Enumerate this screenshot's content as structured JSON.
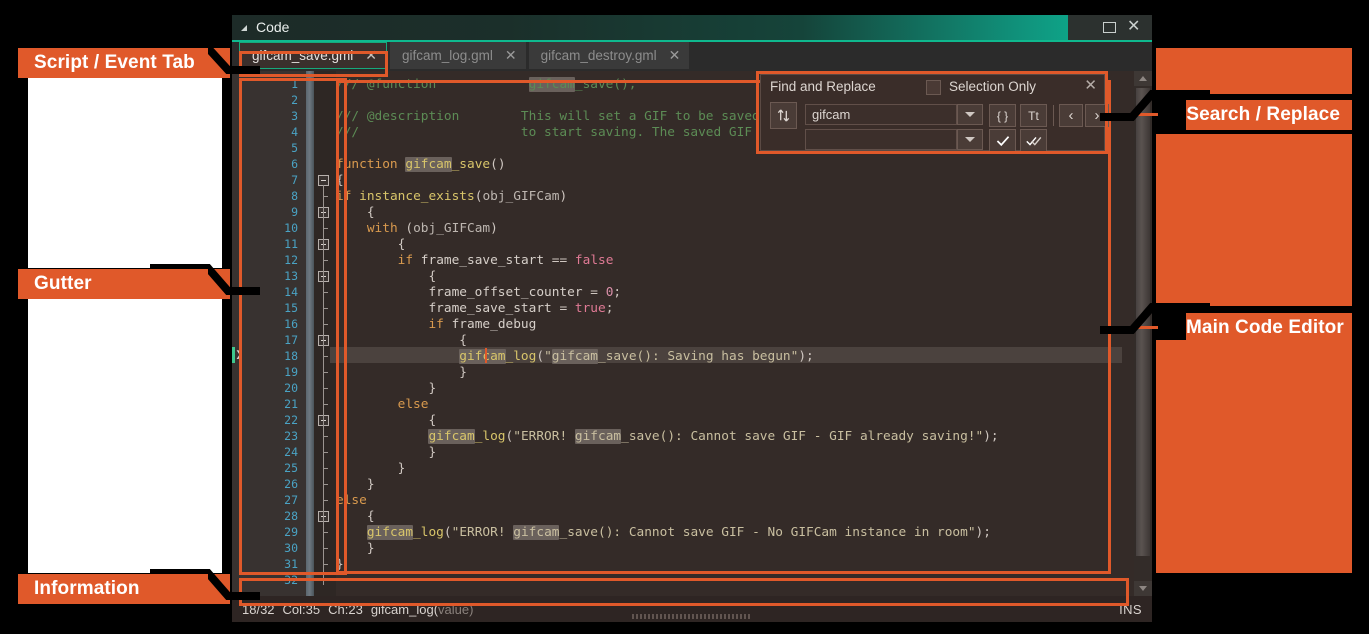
{
  "window": {
    "title": "Code",
    "maximize_label": "Maximize",
    "close_label": "Close"
  },
  "tabs": [
    {
      "label": "gifcam_save.gml",
      "close": "✕",
      "active": true
    },
    {
      "label": "gifcam_log.gml",
      "close": "✕",
      "active": false
    },
    {
      "label": "gifcam_destroy.gml",
      "close": "✕",
      "active": false
    }
  ],
  "find_replace": {
    "title": "Find and Replace",
    "selection_only_label": "Selection Only",
    "close_label": "✕",
    "find_value": "gifcam",
    "replace_value": "",
    "replace_placeholder": "",
    "toggle_icon": "swap-find-replace-icon",
    "buttons": {
      "regex": "{ }",
      "match_case": "Tt",
      "prev": "‹",
      "next": "›",
      "replace_one": "✔",
      "replace_all": "✔✔"
    }
  },
  "gutter": {
    "line_numbers": [
      1,
      2,
      3,
      4,
      5,
      6,
      7,
      8,
      9,
      10,
      11,
      12,
      13,
      14,
      15,
      16,
      17,
      18,
      19,
      20,
      21,
      22,
      23,
      24,
      25,
      26,
      27,
      28,
      29,
      30,
      31,
      32
    ],
    "current_line_marker": "❯"
  },
  "code": {
    "current_line": 18,
    "lines": [
      {
        "n": 1,
        "text": "/// @function            gifcam_save();"
      },
      {
        "n": 2,
        "text": ""
      },
      {
        "n": 3,
        "text": "/// @description        This will set a GIF to be saved. Call"
      },
      {
        "n": 4,
        "text": "///                     to start saving. The saved GIF locati"
      },
      {
        "n": 5,
        "text": ""
      },
      {
        "n": 6,
        "text": "function gifcam_save()"
      },
      {
        "n": 7,
        "text": "{"
      },
      {
        "n": 8,
        "text": "if instance_exists(obj_GIFCam)"
      },
      {
        "n": 9,
        "text": "    {"
      },
      {
        "n": 10,
        "text": "    with (obj_GIFCam)"
      },
      {
        "n": 11,
        "text": "        {"
      },
      {
        "n": 12,
        "text": "        if frame_save_start == false"
      },
      {
        "n": 13,
        "text": "            {"
      },
      {
        "n": 14,
        "text": "            frame_offset_counter = 0;"
      },
      {
        "n": 15,
        "text": "            frame_save_start = true;"
      },
      {
        "n": 16,
        "text": "            if frame_debug"
      },
      {
        "n": 17,
        "text": "                {"
      },
      {
        "n": 18,
        "text": "                gifcam_log(\"gifcam_save(): Saving has begun\");"
      },
      {
        "n": 19,
        "text": "                }"
      },
      {
        "n": 20,
        "text": "            }"
      },
      {
        "n": 21,
        "text": "        else"
      },
      {
        "n": 22,
        "text": "            {"
      },
      {
        "n": 23,
        "text": "            gifcam_log(\"ERROR! gifcam_save(): Cannot save GIF - GIF already saving!\");"
      },
      {
        "n": 24,
        "text": "            }"
      },
      {
        "n": 25,
        "text": "        }"
      },
      {
        "n": 26,
        "text": "    }"
      },
      {
        "n": 27,
        "text": "else"
      },
      {
        "n": 28,
        "text": "    {"
      },
      {
        "n": 29,
        "text": "    gifcam_log(\"ERROR! gifcam_save(): Cannot save GIF - No GIFCam instance in room\");"
      },
      {
        "n": 30,
        "text": "    }"
      },
      {
        "n": 31,
        "text": "}"
      },
      {
        "n": 32,
        "text": ""
      }
    ]
  },
  "status_bar": {
    "position": "18/32",
    "column": "Col:35",
    "character": "Ch:23",
    "signature_name": "gifcam_log(",
    "signature_arg": "value)",
    "mode": "INS"
  },
  "annotations": [
    {
      "id": "script-event-tab",
      "label": "Script / Event Tab",
      "side": "left"
    },
    {
      "id": "gutter",
      "label": "Gutter",
      "side": "left"
    },
    {
      "id": "information",
      "label": "Information",
      "side": "left"
    },
    {
      "id": "search-replace",
      "label": "Search / Replace",
      "side": "right"
    },
    {
      "id": "main-code-editor",
      "label": "Main Code Editor",
      "side": "right"
    }
  ],
  "colors": {
    "accent_orange": "#E0592A",
    "accent_teal": "#0fb98f",
    "editor_bg": "#342B28",
    "gutter_bg": "#383230",
    "line_number": "#4aa3c4",
    "comment": "#5c8c55",
    "keyword": "#d99a4e",
    "function": "#d8c56a",
    "string": "#c9bfa0",
    "literal": "#e07a95",
    "number": "#d98fa8",
    "match_highlight": "#6a615c"
  }
}
